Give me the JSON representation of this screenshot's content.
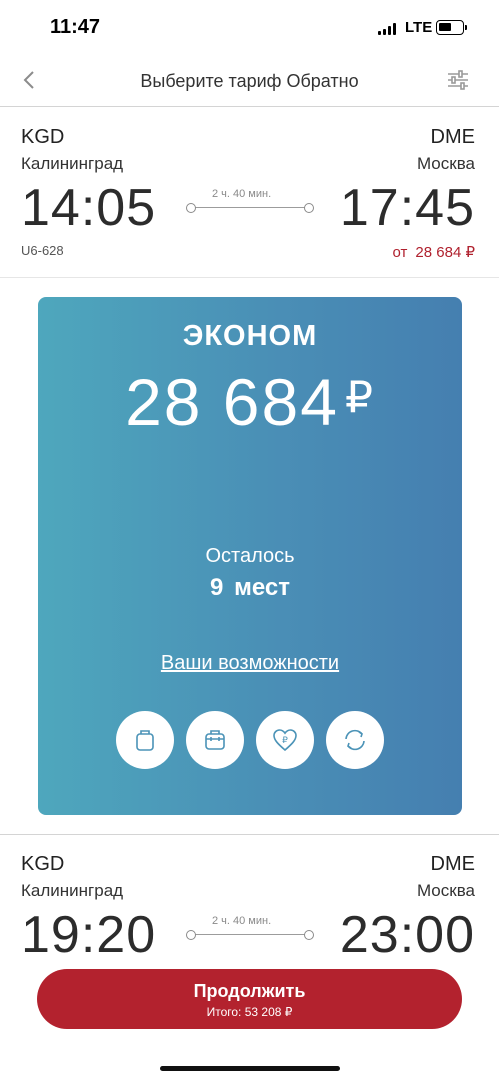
{
  "status_bar": {
    "time": "11:47",
    "network": "LTE"
  },
  "header": {
    "title": "Выберите тариф Обратно",
    "back_icon": "chevron-left-icon",
    "filter_icon": "sliders-icon"
  },
  "flights": [
    {
      "origin_code": "KGD",
      "origin_city": "Калининград",
      "dest_code": "DME",
      "dest_city": "Москва",
      "depart_time": "14:05",
      "arrive_time": "17:45",
      "duration": "2 ч. 40 мин.",
      "flight_number": "U6-628",
      "price_prefix": "от",
      "price": "28 684 ₽"
    },
    {
      "origin_code": "KGD",
      "origin_city": "Калининград",
      "dest_code": "DME",
      "dest_city": "Москва",
      "depart_time": "19:20",
      "arrive_time": "23:00",
      "duration": "2 ч. 40 мин."
    }
  ],
  "tariff": {
    "name": "ЭКОНОМ",
    "price": "28 684",
    "currency": "₽",
    "seats_label": "Осталось",
    "seats_count": "9 мест",
    "link": "Ваши возможности",
    "features": [
      "bag-icon",
      "luggage-icon",
      "heart-ruble-icon",
      "exchange-icon"
    ]
  },
  "bottom": {
    "continue_label": "Продолжить",
    "total": "Итого: 53 208 ₽"
  },
  "colors": {
    "accent": "#b3222e",
    "card_start": "#4ea7bd",
    "card_end": "#457fb0"
  }
}
